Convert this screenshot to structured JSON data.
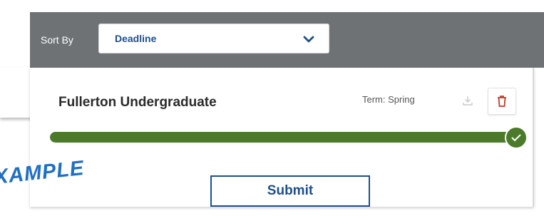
{
  "toolbar": {
    "sort_label": "Sort By",
    "sort_value": "Deadline"
  },
  "card": {
    "title": "Fullerton Undergraduate",
    "term": "Term: Spring",
    "progress_fraction": 1.0,
    "submit_label": "Submit"
  },
  "icons": {
    "sort_dropdown": "chevron-down-icon",
    "download": "download-icon",
    "delete": "trash-icon",
    "progress_complete": "check-icon"
  },
  "colors": {
    "toolbar_bg": "#6e7275",
    "accent_blue": "#1e4f8a",
    "progress_green": "#4b7a2b",
    "delete_red": "#c0392b"
  },
  "watermark": "XAMPLE"
}
